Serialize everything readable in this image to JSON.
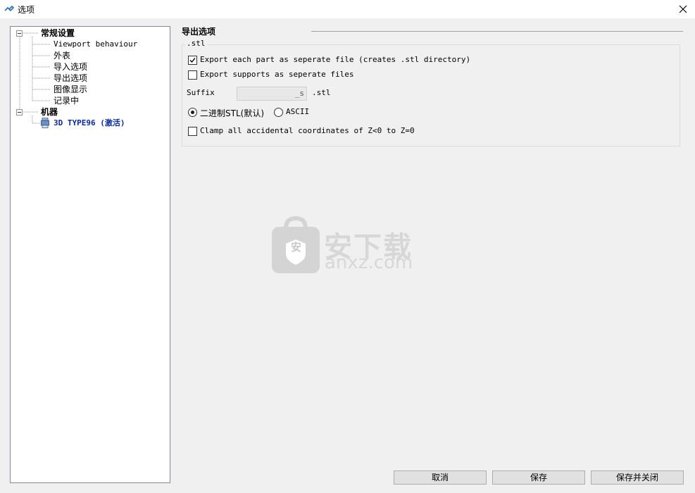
{
  "window": {
    "title": "选项",
    "app_icon": "link-icon",
    "close_icon": "close-icon"
  },
  "tree": {
    "general_group": "常规设置",
    "general_items": [
      "Viewport behaviour",
      "外表",
      "导入选项",
      "导出选项",
      "图像显示",
      "记录中"
    ],
    "machine_group": "机器",
    "machine_item": "3D TYPE96 (激活)",
    "machine_icon": "printer-icon"
  },
  "export": {
    "section_title": "导出选项",
    "group_label": ".stl",
    "opt_each_part": {
      "label": "Export each part as seperate file (creates .stl directory)",
      "checked": true
    },
    "opt_supports": {
      "label": "Export supports as seperate files",
      "checked": false
    },
    "suffix_label": "Suffix",
    "suffix_value": "_s",
    "suffix_ext": ".stl",
    "format_binary": {
      "label": "二进制STL(默认)",
      "selected": true
    },
    "format_ascii": {
      "label": "ASCII",
      "selected": false
    },
    "opt_clamp": {
      "label": "Clamp all accidental coordinates of Z<0 to Z=0",
      "checked": false
    }
  },
  "watermark": {
    "text_cn": "安下载",
    "text_en": "anxz.com",
    "shield_char": "安"
  },
  "buttons": {
    "cancel": "取消",
    "save": "保存",
    "save_close": "保存并关闭"
  }
}
